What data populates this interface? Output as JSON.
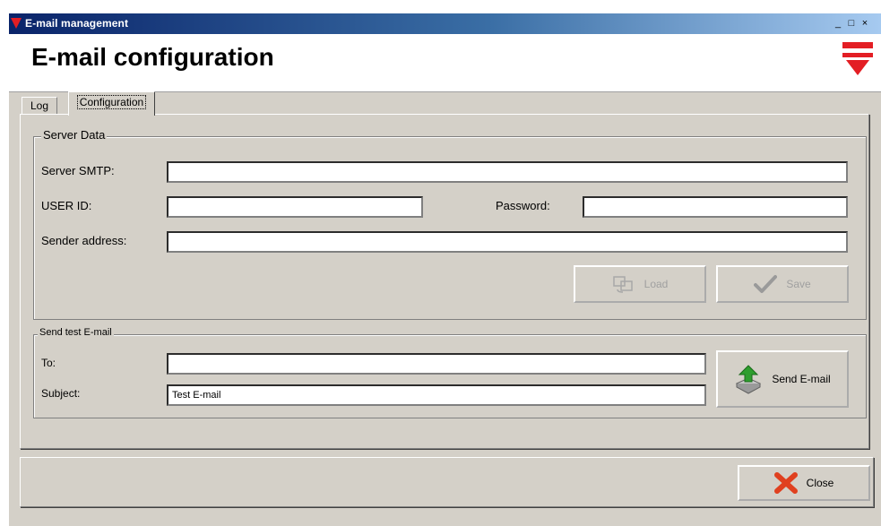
{
  "window": {
    "title": "E-mail management",
    "controls": [
      "_",
      "□",
      "×"
    ]
  },
  "header": {
    "title": "E-mail configuration",
    "logo_icon": "brand-triangle-logo",
    "brand_color": "#e31e24"
  },
  "tabs": [
    {
      "label": "Log",
      "active": false
    },
    {
      "label": "Configuration",
      "active": true
    }
  ],
  "server_data": {
    "group_label": "Server Data",
    "smtp_label": "Server SMTP:",
    "smtp_value": "",
    "user_label": "USER ID:",
    "user_value": "",
    "password_label": "Password:",
    "password_value": "",
    "sender_label": "Sender address:",
    "sender_value": "",
    "load_label": "Load",
    "save_label": "Save"
  },
  "test_email": {
    "group_label": "Send test E-mail",
    "to_label": "To:",
    "to_value": "",
    "subject_label": "Subject:",
    "subject_value": "Test E-mail",
    "send_label": "Send E-mail"
  },
  "footer": {
    "close_label": "Close"
  }
}
